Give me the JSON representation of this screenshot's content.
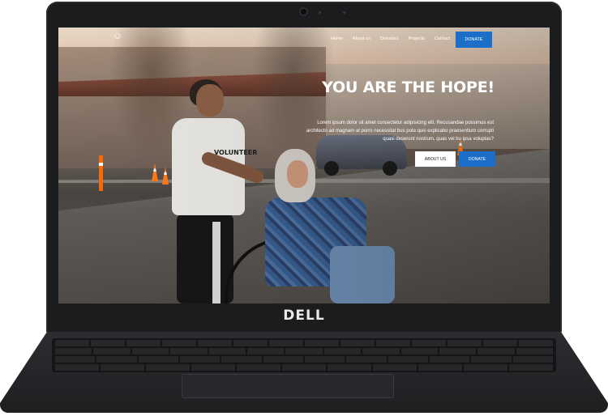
{
  "device": {
    "brand": "DELL"
  },
  "website": {
    "nav": {
      "items": [
        "Home",
        "About us",
        "Donators",
        "Projects",
        "Contact"
      ],
      "cta": "DONATE"
    },
    "hero": {
      "title": "YOU ARE THE HOPE!",
      "text": "Lorem ipsum dolor sit amet consectetur adipisicing elit. Recusandae possimus est architecto ad magnam at porro necessitat bus pota quis explicabo praesentium corrupti quasi deserunt nostrum, quas vel bu ipsa voluptas?",
      "buttons": {
        "about": "ABOUT US",
        "donate": "DONATE"
      }
    }
  },
  "colors": {
    "primary": "#1c6fc9",
    "text_light": "#ffffff",
    "laptop_body": "#1b1c1e"
  },
  "icons": {
    "logo": "heart-hands-icon"
  }
}
